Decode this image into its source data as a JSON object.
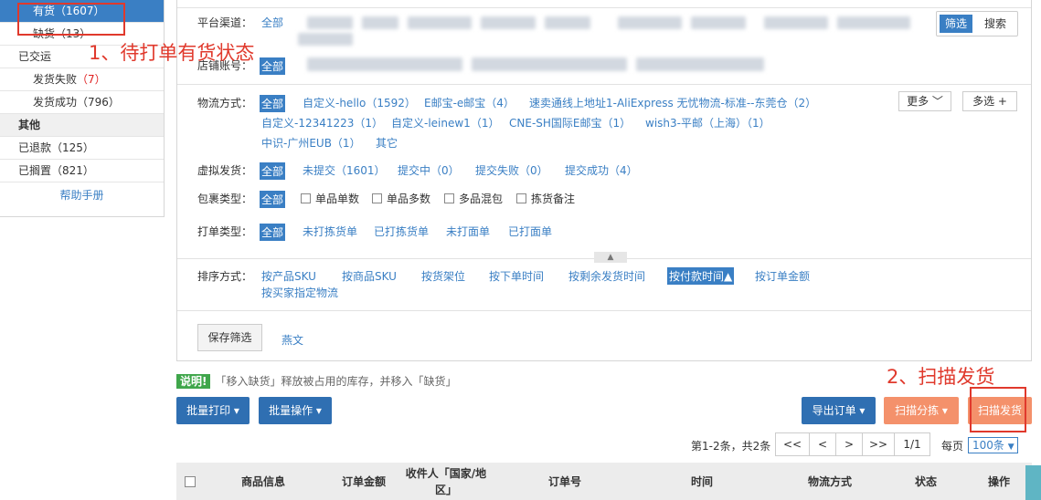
{
  "sidebar": {
    "items": [
      {
        "label": "有货",
        "count": "（1607）",
        "active": true,
        "sub": true
      },
      {
        "label": "缺货",
        "count": "（13）",
        "sub": true
      },
      {
        "label": "已交运",
        "count": ""
      },
      {
        "label": "发货失败",
        "count": "（7）",
        "sub": true,
        "red": true
      },
      {
        "label": "发货成功",
        "count": "（796）",
        "sub": true
      },
      {
        "label": "其他",
        "count": "",
        "group": true
      },
      {
        "label": "已退款",
        "count": "（125）"
      },
      {
        "label": "已搁置",
        "count": "（821）"
      }
    ],
    "help": "帮助手册"
  },
  "filters": {
    "platform": {
      "label": "平台渠道：",
      "all": "全部"
    },
    "store": {
      "label": "店铺账号：",
      "all": "全部"
    },
    "logistics": {
      "label": "物流方式：",
      "all": "全部",
      "options": [
        "自定义-hello（1592）",
        "E邮宝-e邮宝（4）",
        "速卖通线上地址1-AliExpress 无忧物流-标准--东莞仓（2）",
        "自定义-12341223（1）",
        "自定义-leinew1（1）",
        "CNE-SH国际E邮宝（1）",
        "wish3-平邮（上海）（1）",
        "中识-广州EUB（1）",
        "其它"
      ],
      "more": "更多",
      "multi": "多选 +"
    },
    "virtual": {
      "label": "虚拟发货：",
      "all": "全部",
      "options": [
        "未提交（1601）",
        "提交中（0）",
        "提交失败（0）",
        "提交成功（4）"
      ]
    },
    "package": {
      "label": "包裹类型：",
      "all": "全部",
      "options": [
        "单品单数",
        "单品多数",
        "多品混包",
        "拣货备注"
      ]
    },
    "print": {
      "label": "打单类型：",
      "all": "全部",
      "options": [
        "未打拣货单",
        "已打拣货单",
        "未打面单",
        "已打面单"
      ]
    },
    "sort": {
      "label": "排序方式：",
      "options": [
        "按产品SKU",
        "按商品SKU",
        "按货架位",
        "按下单时间",
        "按剩余发货时间",
        "按付款时间",
        "按订单金额",
        "按买家指定物流"
      ],
      "selected_suffix": "▲"
    },
    "toggle": {
      "filter": "筛选",
      "search": "搜索"
    },
    "save": "保存筛选",
    "saved": "燕文"
  },
  "tip": {
    "tag": "说明!",
    "text": "「移入缺货」释放被占用的库存，并移入「缺货」"
  },
  "toolbar": {
    "batch_print": "批量打印 ▾",
    "batch_ops": "批量操作 ▾",
    "export": "导出订单 ▾",
    "scan_sort": "扫描分拣 ▾",
    "scan_ship": "扫描发货"
  },
  "pagination": {
    "summary": "第1-2条，共2条",
    "first": "<<",
    "prev": "<",
    "next": ">",
    "last": ">>",
    "page": "1/1",
    "per_page_label": "每页",
    "per_page": "100条"
  },
  "table": {
    "headers": [
      "商品信息",
      "订单金额",
      "收件人「国家/地区」",
      "订单号",
      "时间",
      "物流方式",
      "状态",
      "操作"
    ]
  },
  "annotations": {
    "a1": "1、待打单有货状态",
    "a2": "2、扫描发货"
  },
  "colors": {
    "primary": "#3a7fc4",
    "orange": "#f4916b",
    "annotation_red": "#e0392c",
    "tip_green": "#3fa64b"
  }
}
